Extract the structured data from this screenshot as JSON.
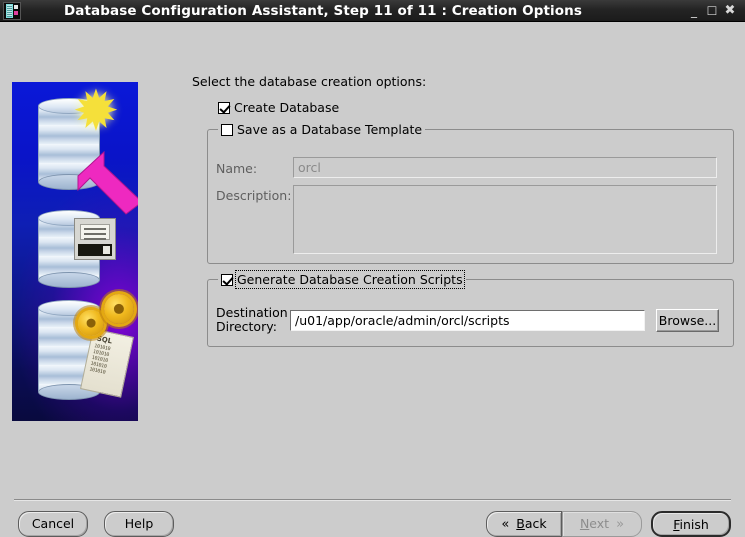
{
  "window": {
    "title": "Database Configuration Assistant, Step 11 of 11 : Creation Options",
    "icon": "database-app-icon",
    "controls": {
      "minimize": "_",
      "maximize": "☐",
      "close": "✖"
    }
  },
  "sidebar_graphic": {
    "name": "database-creation-illustration",
    "star": "✹",
    "scroll_label": "SQL",
    "scroll_bits": [
      "101010",
      "101010",
      "101010",
      "101010"
    ]
  },
  "main": {
    "intro_label": "Select the database creation options:",
    "create_database": {
      "label": "Create Database",
      "checked": true
    },
    "template_group": {
      "legend": "Save as a Database Template",
      "checked": false,
      "focused": false,
      "name_label": "Name:",
      "name_value": "orcl",
      "name_disabled": true,
      "description_label": "Description:",
      "description_value": "",
      "description_disabled": true
    },
    "scripts_group": {
      "legend": "Generate Database Creation Scripts",
      "checked": true,
      "focused": true,
      "destination_label_line1": "Destination",
      "destination_label_line2": "Directory:",
      "destination_value": "/u01/app/oracle/admin/orcl/scripts",
      "browse_label": "Browse..."
    }
  },
  "footer": {
    "cancel": "Cancel",
    "help": "Help",
    "back": {
      "label": "Back",
      "mnemonic": "B",
      "rest": "ack",
      "chevron": "«",
      "enabled": true
    },
    "next": {
      "label": "Next",
      "mnemonic": "N",
      "rest": "ext",
      "chevron": "»",
      "enabled": false
    },
    "finish": {
      "label": "Finish",
      "mnemonic": "F",
      "rest": "inish",
      "is_default": true
    }
  },
  "colors": {
    "window_bg": "#cccccc",
    "titlebar_bg": "#242424",
    "titlebar_text": "#ffffff",
    "graphic_blue": "#0a18d8",
    "graphic_purple": "#9600e6",
    "arrow_magenta": "#ee29c0",
    "star_yellow": "#f5e03a",
    "gear_gold": "#f0b91e"
  }
}
